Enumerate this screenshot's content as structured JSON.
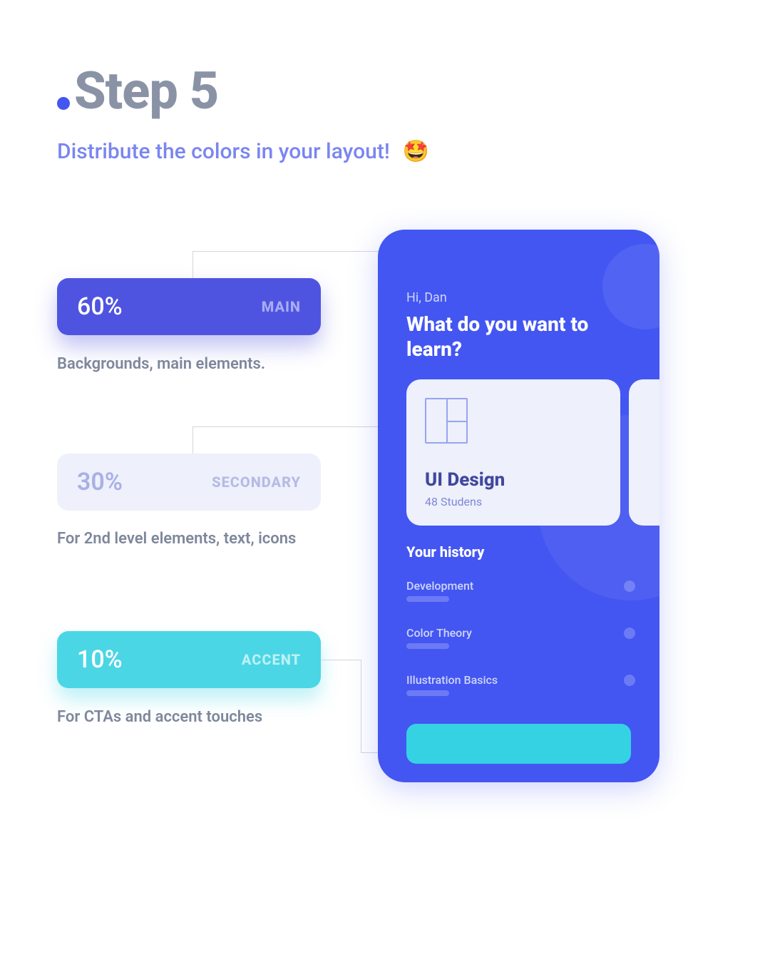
{
  "heading": {
    "title": "Step 5"
  },
  "subtitle": {
    "text": "Distribute the colors in your layout!",
    "emoji": "🤩"
  },
  "colors": {
    "main": {
      "percent": "60%",
      "label": "MAIN",
      "desc": "Backgrounds, main elements.",
      "hex": "#4f54e0"
    },
    "secondary": {
      "percent": "30%",
      "label": "SECONDARY",
      "desc": "For 2nd level elements, text, icons",
      "hex": "#eef0fb"
    },
    "accent": {
      "percent": "10%",
      "label": "ACCENT",
      "desc": "For CTAs and accent touches",
      "hex": "#4bd6e5"
    }
  },
  "device": {
    "greeting": "Hi, Dan",
    "headline": "What do you want to learn?",
    "card": {
      "title": "UI Design",
      "subtitle": "48 Studens"
    },
    "history": {
      "title": "Your history",
      "items": [
        "Development",
        "Color Theory",
        "Illustration Basics"
      ]
    }
  }
}
